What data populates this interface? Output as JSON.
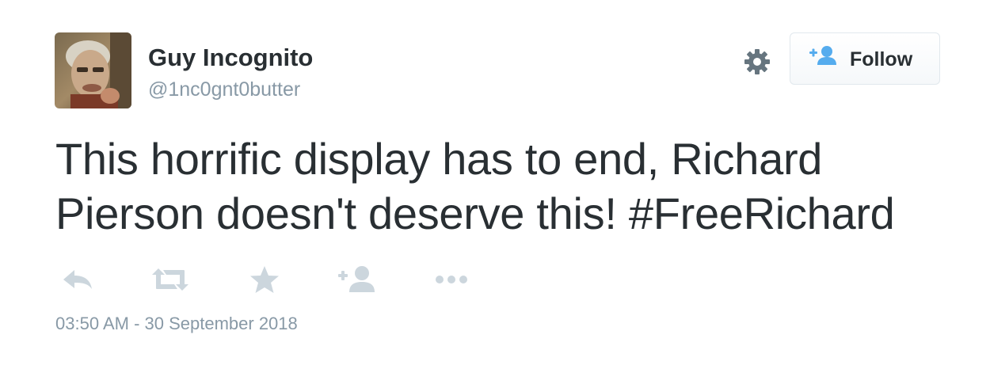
{
  "user": {
    "display_name": "Guy Incognito",
    "handle": "@1nc0gnt0butter"
  },
  "follow_button": {
    "label": "Follow"
  },
  "tweet": {
    "text": "This horrific display has to end, Richard Pierson doesn't deserve this! #FreeRichard",
    "timestamp": "03:50 AM - 30 September 2018"
  },
  "icons": {
    "settings": "gear-icon",
    "follow": "add-user-icon",
    "reply": "reply-icon",
    "retweet": "retweet-icon",
    "favorite": "star-icon",
    "add_user": "add-user-icon",
    "more": "more-icon"
  },
  "colors": {
    "text": "#292f33",
    "secondary_text": "#8899a6",
    "action_icon": "#ccd6dd",
    "follow_icon": "#55acee",
    "gear": "#66757f"
  }
}
